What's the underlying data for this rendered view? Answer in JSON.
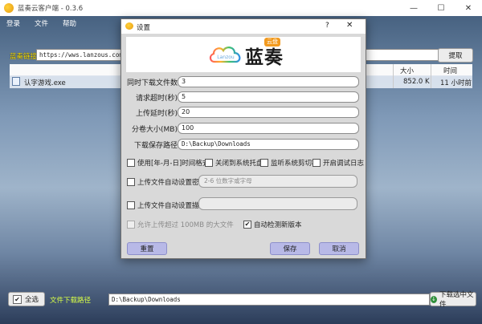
{
  "window": {
    "title": "蓝奏云客户端 - 0.3.6",
    "minimize_glyph": "—",
    "maximize_glyph": "☐",
    "close_glyph": "✕"
  },
  "menu": [
    "登录",
    "文件",
    "帮助"
  ],
  "share_link": {
    "label": "蓝奏链接",
    "value": "https://wws.lanzous.com/i8ICW",
    "extract_label": "提取"
  },
  "table": {
    "headers": {
      "size": "大小",
      "time": "时间"
    },
    "rows": [
      {
        "name": "认字游戏.exe",
        "size": "852.0 K",
        "time": "11 小时前"
      }
    ]
  },
  "footer": {
    "select_all_label": "全选",
    "path_label": "文件下载路径",
    "path_value": "D:\\Backup\\Downloads",
    "download_label": "下载选中文件"
  },
  "dialog": {
    "title": "设置",
    "help_glyph": "?",
    "close_glyph": "✕",
    "logo": {
      "text": "蓝奏",
      "badge": "云盘",
      "cloud_text": "Lanzou"
    },
    "fields": [
      {
        "label": "同时下载文件数",
        "value": "3"
      },
      {
        "label": "请求超时(秒)",
        "value": "5"
      },
      {
        "label": "上传延时(秒)",
        "value": "20"
      },
      {
        "label": "分卷大小(MB)",
        "value": "100"
      },
      {
        "label": "下载保存路径",
        "value": "D:\\Backup\\Downloads"
      }
    ],
    "checkboxes_row1": [
      {
        "label": "使用[年-月-日]时间格式",
        "checked": false
      },
      {
        "label": "关闭到系统托盘",
        "checked": false
      },
      {
        "label": "监听系统剪切板",
        "checked": false
      },
      {
        "label": "开启调试日志",
        "checked": false
      }
    ],
    "upload_password": {
      "label": "上传文件自动设置密码",
      "placeholder": "2-6 位数字或字母",
      "checked": false
    },
    "upload_desc": {
      "label": "上传文件自动设置描述",
      "checked": false
    },
    "allow_large": {
      "label": "允许上传超过 100MB 的大文件",
      "checked": false
    },
    "auto_update": {
      "label": "自动检测新版本",
      "checked": true
    },
    "buttons": {
      "reset": "重置",
      "save": "保存",
      "cancel": "取消"
    }
  },
  "colors": {
    "dialog_button": "#b8b9e7",
    "logo_badge": "#f29a1e",
    "url_label": "#ffe200",
    "path_label": "#d9ff46"
  }
}
